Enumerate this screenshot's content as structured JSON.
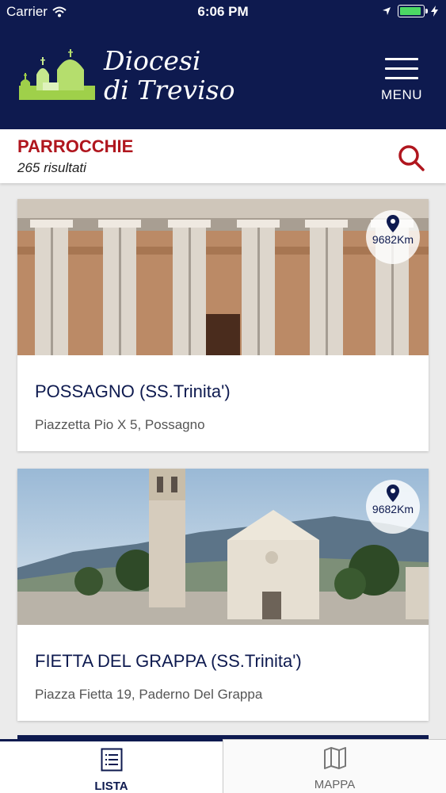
{
  "status_bar": {
    "carrier": "Carrier",
    "time": "6:06 PM",
    "battery_level": 0.95
  },
  "header": {
    "brand_line1": "Diocesi",
    "brand_line2": "di Treviso",
    "menu_label": "MENU",
    "background_color": "#0e1a4f"
  },
  "subheader": {
    "title": "PARROCCHIE",
    "results": "265 risultati",
    "accent_color": "#b0161e"
  },
  "parishes": [
    {
      "name": "POSSAGNO (SS.Trinita')",
      "address": "Piazzetta Pio X 5, Possagno",
      "distance": "9682Km"
    },
    {
      "name": "FIETTA DEL GRAPPA (SS.Trinita')",
      "address": "Piazza Fietta 19, Paderno Del Grappa",
      "distance": "9682Km"
    }
  ],
  "tabs": [
    {
      "label": "LISTA",
      "icon": "list-icon",
      "active": true
    },
    {
      "label": "MAPPA",
      "icon": "map-icon",
      "active": false
    }
  ]
}
